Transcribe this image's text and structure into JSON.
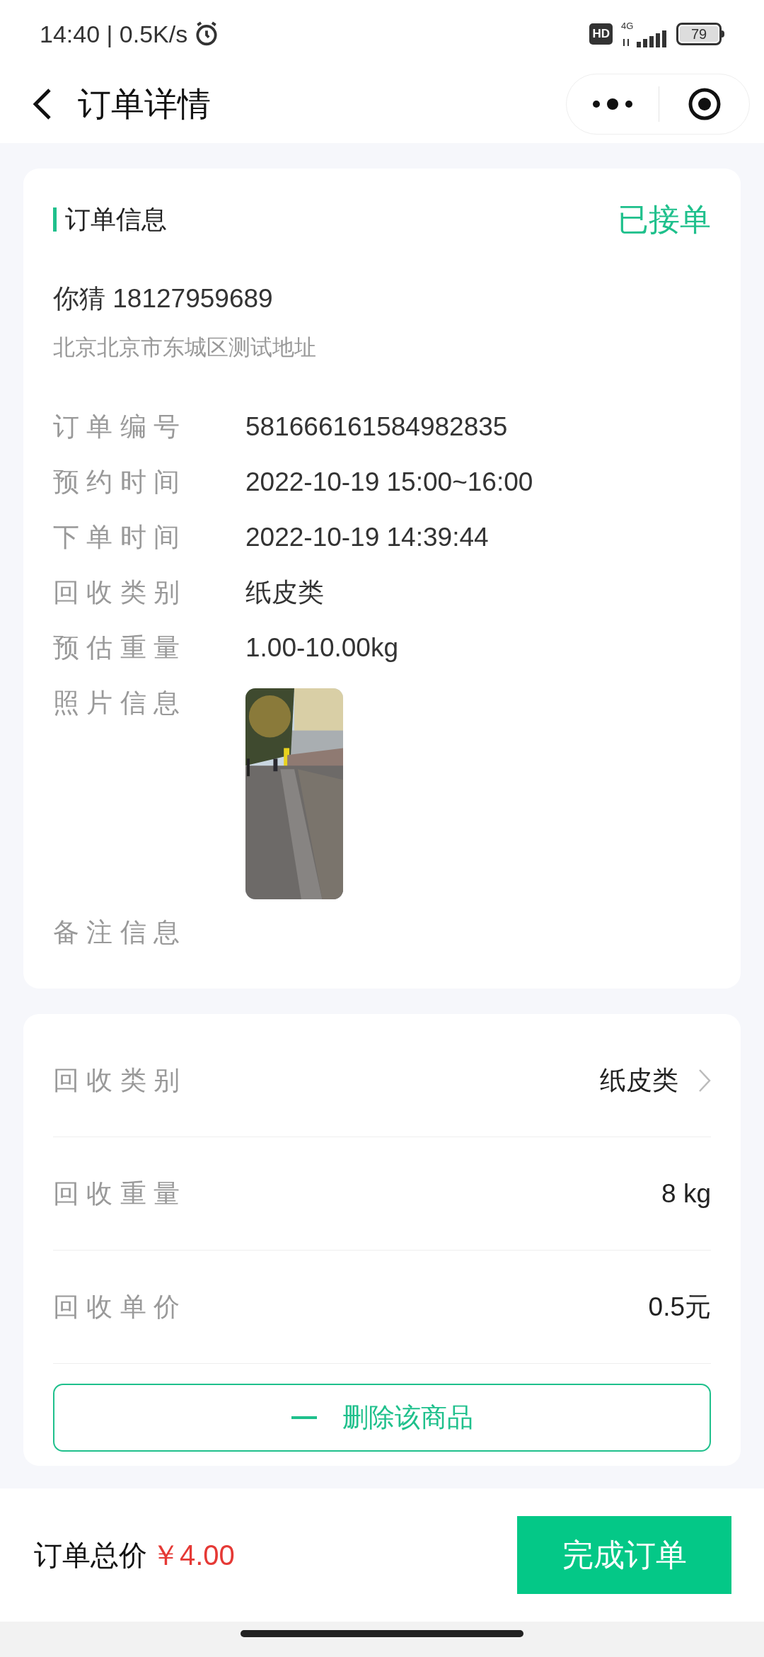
{
  "status_bar": {
    "time": "14:40 | 0.5K/s",
    "battery": "79",
    "network": "4G",
    "hd": "HD"
  },
  "header": {
    "title": "订单详情"
  },
  "order_card": {
    "title": "订单信息",
    "status": "已接单",
    "contact": "你猜 18127959689",
    "address": "北京北京市东城区测试地址",
    "fields": [
      {
        "kind": "text",
        "label": "订 单 编 号",
        "value": "581666161584982835"
      },
      {
        "kind": "text",
        "label": "预 约 时 间",
        "value": "2022-10-19 15:00~16:00"
      },
      {
        "kind": "text",
        "label": "下 单 时 间",
        "value": "2022-10-19 14:39:44"
      },
      {
        "kind": "text",
        "label": "回 收 类 别",
        "value": "纸皮类"
      },
      {
        "kind": "text",
        "label": "预 估 重 量",
        "value": "1.00-10.00kg"
      },
      {
        "label": "照 片 信 息"
      },
      {
        "kind": "text",
        "label": "备 注 信 息"
      }
    ]
  },
  "item_card": {
    "rows": [
      {
        "label": "回 收 类 别",
        "value": "纸皮类",
        "has_arrow": true
      },
      {
        "label": "回 收 重 量",
        "value": "8 kg",
        "has_arrow": false
      },
      {
        "label": "回 收 单 价",
        "value": "0.5元",
        "has_arrow": false
      }
    ],
    "delete_button": "删除该商品"
  },
  "bottom_bar": {
    "total_label": "订单总价",
    "total": "￥4.00",
    "submit": "完成订单"
  }
}
